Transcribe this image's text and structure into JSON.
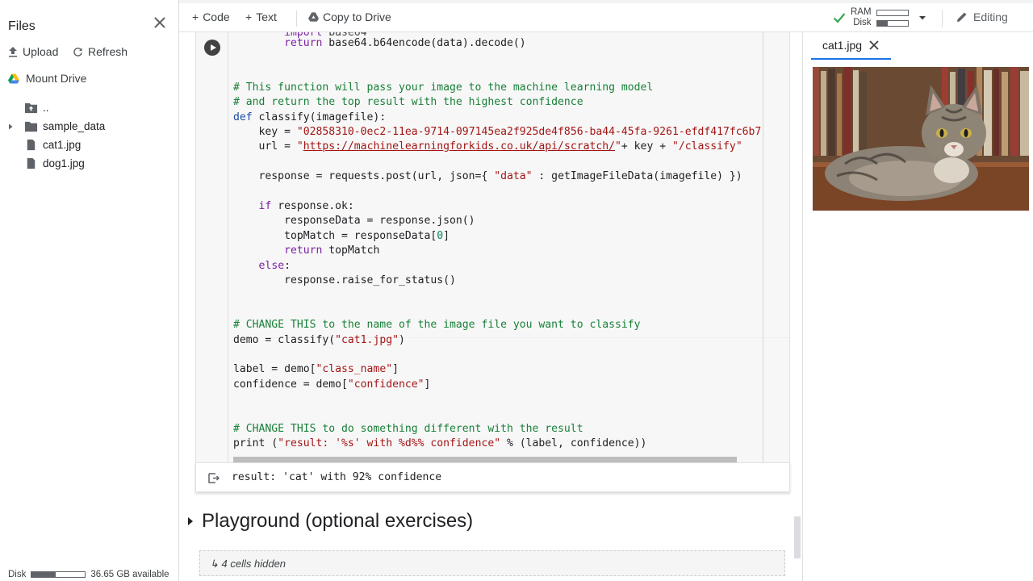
{
  "sidebar": {
    "title": "Files",
    "upload_label": "Upload",
    "refresh_label": "Refresh",
    "mount_label": "Mount Drive",
    "tree": [
      {
        "name": "..",
        "type": "parent-folder"
      },
      {
        "name": "sample_data",
        "type": "folder"
      },
      {
        "name": "cat1.jpg",
        "type": "file"
      },
      {
        "name": "dog1.jpg",
        "type": "file"
      }
    ],
    "disk_label": "Disk",
    "disk_available": "36.65 GB available",
    "disk_used_fraction": 0.45
  },
  "toolbar": {
    "code_label": "Code",
    "text_label": "Text",
    "copy_label": "Copy to Drive",
    "ram_label": "RAM",
    "disk_label": "Disk",
    "ram_fraction": 0.0,
    "disk_fraction": 0.35,
    "editing_label": "Editing"
  },
  "code_lines": [
    "        return base64.b64encode(data).decode()",
    "",
    "",
    "# This function will pass your image to the machine learning model",
    "# and return the top result with the highest confidence",
    "def classify(imagefile):",
    "    key = \"02858310-0ec2-11ea-9714-097145ea2f925de4f856-ba44-45fa-9261-efdf417fc6b7",
    "    url = \"https://machinelearningforkids.co.uk/api/scratch/\"+ key + \"/classify\"",
    "",
    "    response = requests.post(url, json={ \"data\" : getImageFileData(imagefile) })",
    "",
    "    if response.ok:",
    "        responseData = response.json()",
    "        topMatch = responseData[0]",
    "        return topMatch",
    "    else:",
    "        response.raise_for_status()",
    "",
    "",
    "# CHANGE THIS to the name of the image file you want to classify",
    "demo = classify(\"cat1.jpg\")",
    "",
    "label = demo[\"class_name\"]",
    "confidence = demo[\"confidence\"]",
    "",
    "",
    "# CHANGE THIS to do something different with the result",
    "print (\"result: '%s' with %d%% confidence\" % (label, confidence))"
  ],
  "output": {
    "text": "result: 'cat' with 92% confidence"
  },
  "section": {
    "title": "Playground (optional exercises)",
    "hidden_label": "4 cells hidden"
  },
  "viewer": {
    "tab_label": "cat1.jpg"
  },
  "colors": {
    "keyword": "#7b1fa2",
    "string": "#a31515",
    "comment": "#188038",
    "number": "#098658",
    "accent": "#1a73e8"
  }
}
